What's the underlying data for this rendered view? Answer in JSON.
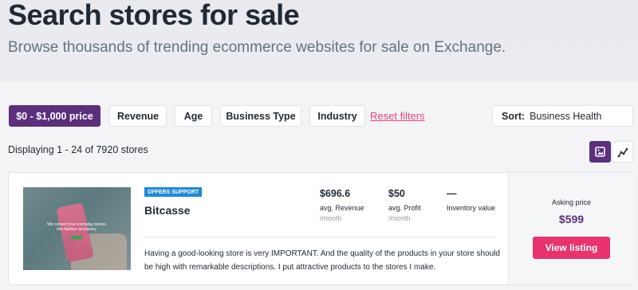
{
  "hero": {
    "title": "Search stores for sale",
    "subtitle": "Browse thousands of trending ecommerce websites for sale on Exchange."
  },
  "filters": {
    "price": "$0 - $1,000 price",
    "revenue": "Revenue",
    "age": "Age",
    "business_type": "Business Type",
    "industry": "Industry",
    "reset": "Reset filters"
  },
  "sort": {
    "label": "Sort:",
    "value": "Business Health"
  },
  "results": {
    "count_text": "Displaying 1 - 24 of 7920 stores"
  },
  "view_toggle": {
    "grid_icon": "image-icon",
    "list_icon": "chart-line-icon"
  },
  "listing": {
    "badge": "OFFERS SUPPORT",
    "name": "Bitcasse",
    "thumbnail_caption": "We convert your everyday device into fashion accessory",
    "revenue_value": "$696.6",
    "revenue_label": "avg. Revenue",
    "revenue_unit": "/month",
    "profit_value": "$50",
    "profit_label": "avg. Profit",
    "profit_unit": "/month",
    "inventory_value": "—",
    "inventory_label": "Inventory value",
    "description": "Having a good-looking store is very IMPORTANT. And the quality of the products in your store should be high with remarkable descriptions. I put attractive products to the stores I make.",
    "asking_label": "Asking price",
    "asking_price": "$599",
    "cta": "View listing"
  },
  "colors": {
    "brand_purple": "#5c2f7c",
    "cta_pink": "#e8336e",
    "badge_blue": "#1f8ad6",
    "link_pink": "#e0477a"
  }
}
